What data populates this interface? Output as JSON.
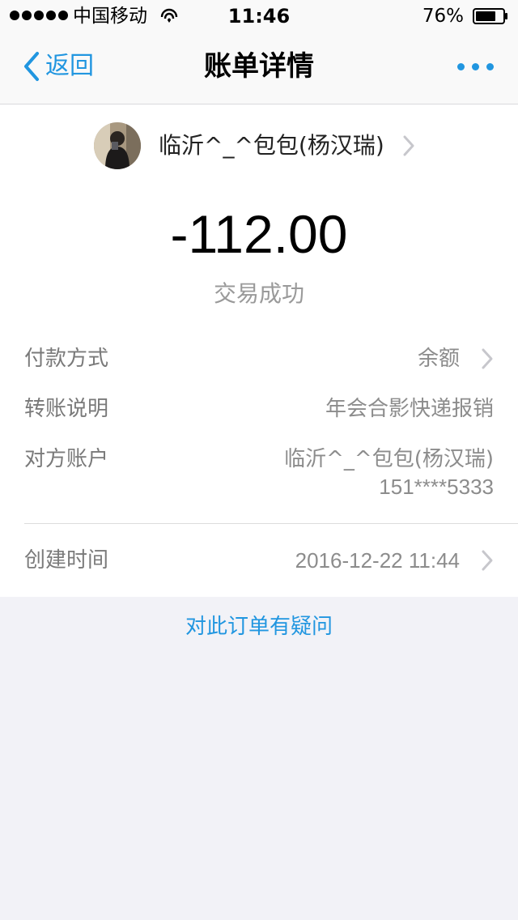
{
  "status_bar": {
    "carrier": "中国移动",
    "time": "11:46",
    "battery_percent": "76%",
    "battery_level": 0.76,
    "signal_bars": 5
  },
  "nav": {
    "back_label": "返回",
    "title": "账单详情"
  },
  "payee": {
    "name": "临沂^_^包包(杨汉瑞)"
  },
  "transaction": {
    "amount": "-112.00",
    "status": "交易成功"
  },
  "details": {
    "payment_method_label": "付款方式",
    "payment_method_value": "余额",
    "note_label": "转账说明",
    "note_value": "年会合影快递报销",
    "counterparty_label": "对方账户",
    "counterparty_name": "临沂^_^包包(杨汉瑞)",
    "counterparty_phone": "151****5333",
    "created_label": "创建时间",
    "created_value": "2016-12-22 11:44"
  },
  "question_link": "对此订单有疑问",
  "colors": {
    "accent": "#2196e0",
    "page_bg": "#f2f2f7",
    "label_gray": "#7a7a7a"
  },
  "icons": {
    "back": "chevron-left-icon",
    "more": "more-dots-icon",
    "row_arrow": "chevron-right-icon",
    "wifi": "wifi-icon",
    "battery": "battery-icon"
  }
}
